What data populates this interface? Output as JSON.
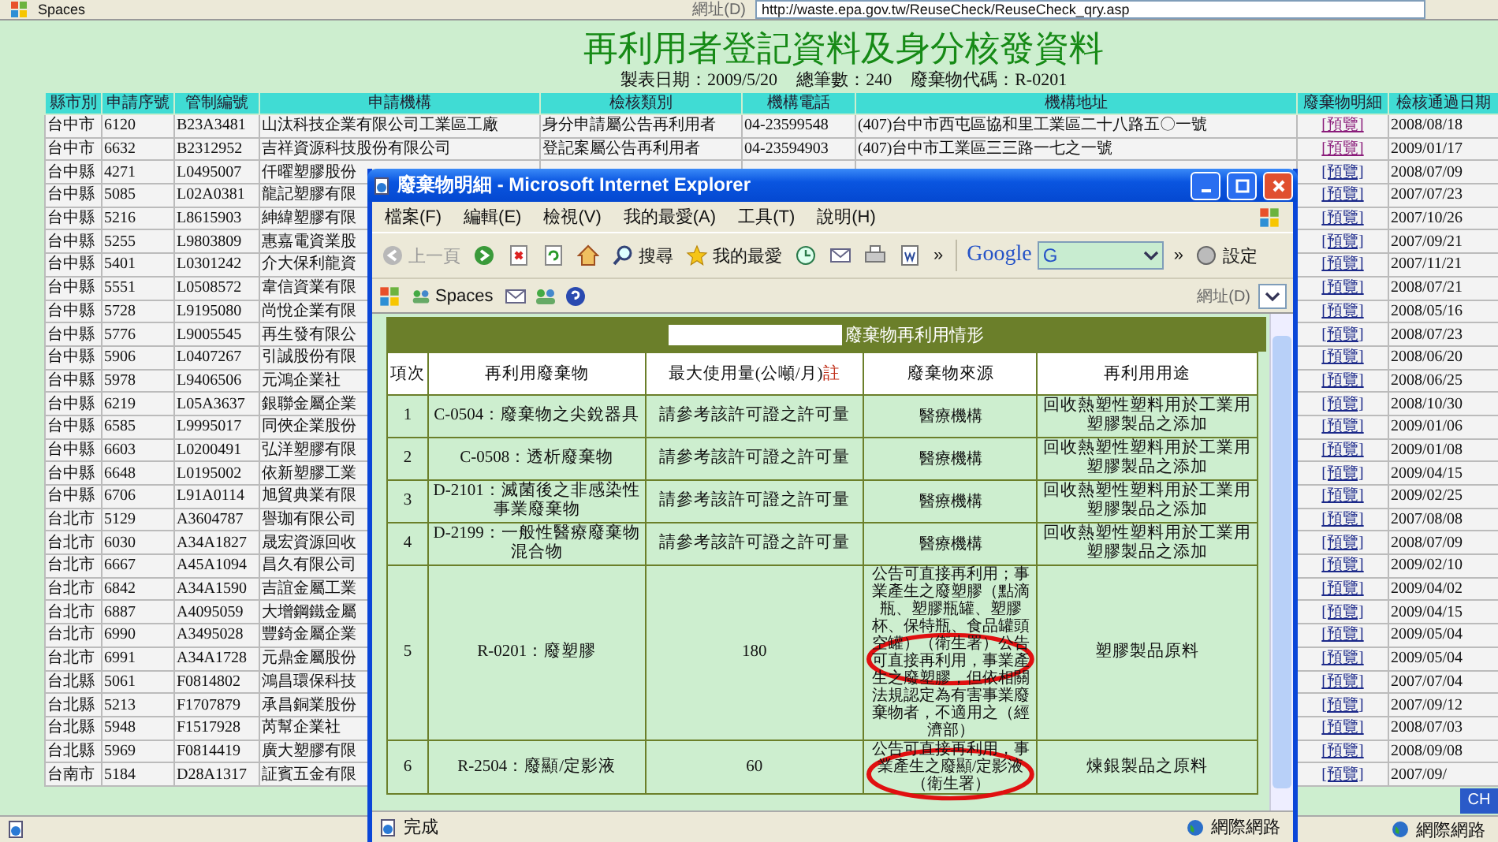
{
  "browser_top": {
    "toolbar_items": [
      "Spaces"
    ],
    "address_label": "網址(D)",
    "url": "http://waste.epa.gov.tw/ReuseCheck/ReuseCheck_qry.asp"
  },
  "page": {
    "title": "再利用者登記資料及身分核發資料",
    "meta": [
      "製表日期：2009/5/20",
      "總筆數：240",
      "廢棄物代碼：R-0201"
    ]
  },
  "table": {
    "columns": [
      "縣市別",
      "申請序號",
      "管制編號",
      "申請機構",
      "檢核類別",
      "機構電話",
      "機構地址",
      "廢棄物明細",
      "檢核通過日期"
    ],
    "rows": [
      {
        "county": "台中市",
        "seq": "6120",
        "control_no": "B23A3481",
        "org": "山汰科技企業有限公司工業區工廠",
        "category": "身分申請屬公告再利用者",
        "phone": "04-23599548",
        "address": "(407)台中市西屯區協和里工業區二十八路五〇一號",
        "detail": "[預覽]",
        "visited": true,
        "date": "2008/08/18"
      },
      {
        "county": "台中市",
        "seq": "6632",
        "control_no": "B2312952",
        "org": "吉祥資源科技股份有限公司",
        "category": "登記案屬公告再利用者",
        "phone": "04-23594903",
        "address": "(407)台中市工業區三三路一七之一號",
        "detail": "[預覽]",
        "visited": true,
        "date": "2009/01/17"
      },
      {
        "county": "台中縣",
        "seq": "4271",
        "control_no": "L0495007",
        "org": "仟曜塑膠股份",
        "detail": "[預覽]",
        "visited": false,
        "date": "2008/07/09"
      },
      {
        "county": "台中縣",
        "seq": "5085",
        "control_no": "L02A0381",
        "org": "龍記塑膠有限",
        "detail": "[預覽]",
        "visited": false,
        "date": "2007/07/23"
      },
      {
        "county": "台中縣",
        "seq": "5216",
        "control_no": "L8615903",
        "org": "紳緯塑膠有限",
        "detail": "[預覽]",
        "visited": false,
        "date": "2007/10/26"
      },
      {
        "county": "台中縣",
        "seq": "5255",
        "control_no": "L9803809",
        "org": "惠嘉電資業股",
        "detail": "[預覽]",
        "visited": false,
        "date": "2007/09/21"
      },
      {
        "county": "台中縣",
        "seq": "5401",
        "control_no": "L0301242",
        "org": "介大保利龍資",
        "detail": "[預覽]",
        "visited": false,
        "date": "2007/11/21"
      },
      {
        "county": "台中縣",
        "seq": "5551",
        "control_no": "L0508572",
        "org": "韋信資業有限",
        "detail": "[預覽]",
        "visited": false,
        "date": "2008/07/21"
      },
      {
        "county": "台中縣",
        "seq": "5728",
        "control_no": "L9195080",
        "org": "尚悅企業有限",
        "detail": "[預覽]",
        "visited": false,
        "date": "2008/05/16"
      },
      {
        "county": "台中縣",
        "seq": "5776",
        "control_no": "L9005545",
        "org": "再生發有限公",
        "detail": "[預覽]",
        "visited": false,
        "date": "2008/07/23"
      },
      {
        "county": "台中縣",
        "seq": "5906",
        "control_no": "L0407267",
        "org": "引誠股份有限",
        "detail": "[預覽]",
        "visited": false,
        "date": "2008/06/20"
      },
      {
        "county": "台中縣",
        "seq": "5978",
        "control_no": "L9406506",
        "org": "元鴻企業社",
        "detail": "[預覽]",
        "visited": false,
        "date": "2008/06/25"
      },
      {
        "county": "台中縣",
        "seq": "6219",
        "control_no": "L05A3637",
        "org": "銀聯金屬企業",
        "detail": "[預覽]",
        "visited": false,
        "date": "2008/10/30"
      },
      {
        "county": "台中縣",
        "seq": "6585",
        "control_no": "L9995017",
        "org": "同俠企業股份",
        "detail": "[預覽]",
        "visited": false,
        "date": "2009/01/06"
      },
      {
        "county": "台中縣",
        "seq": "6603",
        "control_no": "L0200491",
        "org": "弘洋塑膠有限",
        "detail": "[預覽]",
        "visited": false,
        "date": "2009/01/08"
      },
      {
        "county": "台中縣",
        "seq": "6648",
        "control_no": "L0195002",
        "org": "依新塑膠工業",
        "detail": "[預覽]",
        "visited": false,
        "date": "2009/04/15"
      },
      {
        "county": "台中縣",
        "seq": "6706",
        "control_no": "L91A0114",
        "org": "旭貿典業有限",
        "detail": "[預覽]",
        "visited": false,
        "date": "2009/02/25"
      },
      {
        "county": "台北市",
        "seq": "5129",
        "control_no": "A3604787",
        "org": "譽珈有限公司",
        "detail": "[預覽]",
        "visited": false,
        "date": "2007/08/08"
      },
      {
        "county": "台北市",
        "seq": "6030",
        "control_no": "A34A1827",
        "org": "晟宏資源回收",
        "detail": "[預覽]",
        "visited": false,
        "date": "2008/07/09"
      },
      {
        "county": "台北市",
        "seq": "6667",
        "control_no": "A45A1094",
        "org": "昌久有限公司",
        "detail": "[預覽]",
        "visited": false,
        "date": "2009/02/10"
      },
      {
        "county": "台北市",
        "seq": "6842",
        "control_no": "A34A1590",
        "org": "吉誼金屬工業",
        "detail": "[預覽]",
        "visited": false,
        "date": "2009/04/02"
      },
      {
        "county": "台北市",
        "seq": "6887",
        "control_no": "A4095059",
        "org": "大增鋼鐵金屬",
        "detail": "[預覽]",
        "visited": false,
        "date": "2009/04/15"
      },
      {
        "county": "台北市",
        "seq": "6990",
        "control_no": "A3495028",
        "org": "豐錡金屬企業",
        "detail": "[預覽]",
        "visited": false,
        "date": "2009/05/04"
      },
      {
        "county": "台北市",
        "seq": "6991",
        "control_no": "A34A1728",
        "org": "元鼎金屬股份",
        "detail": "[預覽]",
        "visited": false,
        "date": "2009/05/04"
      },
      {
        "county": "台北縣",
        "seq": "5061",
        "control_no": "F0814802",
        "org": "鴻昌環保科技",
        "detail": "[預覽]",
        "visited": false,
        "date": "2007/07/04"
      },
      {
        "county": "台北縣",
        "seq": "5213",
        "control_no": "F1707879",
        "org": "承昌銅業股份",
        "detail": "[預覽]",
        "visited": false,
        "date": "2007/09/12"
      },
      {
        "county": "台北縣",
        "seq": "5948",
        "control_no": "F1517928",
        "org": "芮幫企業社",
        "detail": "[預覽]",
        "visited": false,
        "date": "2008/07/03"
      },
      {
        "county": "台北縣",
        "seq": "5969",
        "control_no": "F0814419",
        "org": "廣大塑膠有限",
        "detail": "[預覽]",
        "visited": false,
        "date": "2008/09/08"
      },
      {
        "county": "台南市",
        "seq": "5184",
        "control_no": "D28A1317",
        "org": "証賓五金有限",
        "detail": "[預覽]",
        "visited": false,
        "date": "2007/09/"
      }
    ]
  },
  "popup": {
    "title": "廢棄物明細 - Microsoft Internet Explorer",
    "menu": [
      "檔案(F)",
      "編輯(E)",
      "檢視(V)",
      "我的最愛(A)",
      "工具(T)",
      "說明(H)"
    ],
    "toolbar": [
      {
        "kind": "back",
        "label": "上一頁",
        "disabled": true
      },
      {
        "kind": "forward",
        "disabled": false
      },
      {
        "kind": "stop"
      },
      {
        "kind": "refresh"
      },
      {
        "kind": "home"
      },
      {
        "kind": "search",
        "label": "搜尋"
      },
      {
        "kind": "favorites",
        "label": "我的最愛"
      },
      {
        "kind": "history"
      },
      {
        "kind": "mail"
      },
      {
        "kind": "print"
      },
      {
        "kind": "edit"
      },
      {
        "kind": "more",
        "label": "»"
      }
    ],
    "google": {
      "logo": "Google",
      "field": "G",
      "more": "»",
      "settings": "設定"
    },
    "links_bar": {
      "items": [
        "Spaces"
      ],
      "address_label": "網址(D)"
    },
    "content": {
      "heading": "廢棄物再利用情形",
      "columns": [
        {
          "label": "項次"
        },
        {
          "label": "再利用廢棄物"
        },
        {
          "label": "最大使用量(公噸/月)",
          "note": "註"
        },
        {
          "label": "廢棄物來源"
        },
        {
          "label": "再利用用途"
        }
      ],
      "rows": [
        {
          "no": "1",
          "waste": "C-0504：廢棄物之尖銳器具",
          "amount": "請參考該許可證之許可量",
          "source": "醫療機構",
          "source_circled": false,
          "use": "回收熱塑性塑料用於工業用塑膠製品之添加"
        },
        {
          "no": "2",
          "waste": "C-0508：透析廢棄物",
          "amount": "請參考該許可證之許可量",
          "source": "醫療機構",
          "source_circled": false,
          "use": "回收熱塑性塑料用於工業用塑膠製品之添加"
        },
        {
          "no": "3",
          "waste": "D-2101：滅菌後之非感染性事業廢棄物",
          "amount": "請參考該許可證之許可量",
          "source": "醫療機構",
          "source_circled": false,
          "use": "回收熱塑性塑料用於工業用塑膠製品之添加"
        },
        {
          "no": "4",
          "waste": "D-2199：一般性醫療廢棄物混合物",
          "amount": "請參考該許可證之許可量",
          "source": "醫療機構",
          "source_circled": false,
          "use": "回收熱塑性塑料用於工業用塑膠製品之添加"
        },
        {
          "no": "5",
          "waste": "R-0201：廢塑膠",
          "amount": "180",
          "source": "公告可直接再利用；事業產生之廢塑膠（點滴瓶、塑膠瓶罐、塑膠杯、保特瓶、食品罐頭空罐）（衛生署）公告可直接再利用，事業產生之廢塑膠，但依相關法規認定為有害事業廢棄物者，不適用之（經濟部）",
          "source_circled": true,
          "use": "塑膠製品原料"
        },
        {
          "no": "6",
          "waste": "R-2504：廢顯/定影液",
          "amount": "60",
          "source": "公告可直接再利用，事業產生之廢顯/定影液（衛生署）",
          "source_circled": true,
          "use": "煉銀製品之原料"
        }
      ]
    },
    "status": "完成",
    "zone": "網際網路"
  },
  "status_bar": {
    "zone": "網際網路",
    "language": "CH"
  }
}
